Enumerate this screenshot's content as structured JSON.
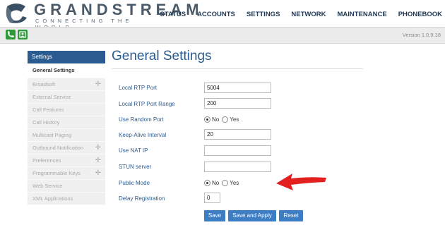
{
  "brand": {
    "name": "GRANDSTREAM",
    "tagline": "CONNECTING THE WORLD"
  },
  "topnav": [
    "STATUS",
    "ACCOUNTS",
    "SETTINGS",
    "NETWORK",
    "MAINTENANCE",
    "PHONEBOOK"
  ],
  "toolbar": {
    "version": "Version 1.0.9.18",
    "icons": [
      "phone-icon",
      "contacts-icon"
    ]
  },
  "sidebar": {
    "header": "Settings",
    "items": [
      {
        "label": "General Settings",
        "active": true,
        "expandable": false
      },
      {
        "label": "Broadsoft",
        "active": false,
        "expandable": true
      },
      {
        "label": "External Service",
        "active": false,
        "expandable": false
      },
      {
        "label": "Call Features",
        "active": false,
        "expandable": false
      },
      {
        "label": "Call History",
        "active": false,
        "expandable": false
      },
      {
        "label": "Multicast Paging",
        "active": false,
        "expandable": false
      },
      {
        "label": "Outbound Notification",
        "active": false,
        "expandable": true
      },
      {
        "label": "Preferences",
        "active": false,
        "expandable": true
      },
      {
        "label": "Programmable Keys",
        "active": false,
        "expandable": true
      },
      {
        "label": "Web Service",
        "active": false,
        "expandable": false
      },
      {
        "label": "XML Applications",
        "active": false,
        "expandable": false
      }
    ]
  },
  "main": {
    "title": "General Settings",
    "fields": {
      "local_rtp_port": {
        "label": "Local RTP Port",
        "value": "5004"
      },
      "local_rtp_port_range": {
        "label": "Local RTP Port Range",
        "value": "200"
      },
      "use_random_port": {
        "label": "Use Random Port",
        "selected": "No",
        "no": "No",
        "yes": "Yes"
      },
      "keep_alive_interval": {
        "label": "Keep-Alive Interval",
        "value": "20"
      },
      "use_nat_ip": {
        "label": "Use NAT IP",
        "value": ""
      },
      "stun_server": {
        "label": "STUN server",
        "value": ""
      },
      "public_mode": {
        "label": "Public Mode",
        "selected": "No",
        "no": "No",
        "yes": "Yes"
      },
      "delay_registration": {
        "label": "Delay Registration",
        "value": "0"
      }
    },
    "buttons": {
      "save": "Save",
      "save_apply": "Save and Apply",
      "reset": "Reset"
    }
  },
  "colors": {
    "accent": "#2a5b91",
    "button": "#3d7dc4",
    "annotation_arrow": "#e32020"
  }
}
